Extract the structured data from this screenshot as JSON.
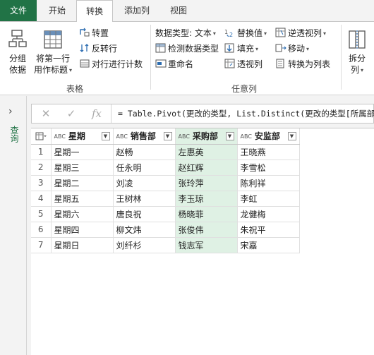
{
  "tabs": {
    "file": "文件",
    "home": "开始",
    "transform": "转换",
    "add_column": "添加列",
    "view": "视图"
  },
  "ribbon": {
    "table_group": {
      "label": "表格",
      "group_by": "分组\n依据",
      "use_first_row": "将第一行\n用作标题",
      "transpose": "转置",
      "reverse_rows": "反转行",
      "count_rows": "对行进行计数"
    },
    "any_column_group": {
      "label": "任意列",
      "data_type": "数据类型: 文本",
      "detect_type": "检测数据类型",
      "rename": "重命名",
      "replace_values": "替换值",
      "fill": "填充",
      "pivot": "透视列",
      "unpivot": "逆透视列",
      "move": "移动",
      "to_list": "转换为列表"
    },
    "split_column": "拆分\n列"
  },
  "nav": {
    "label": "查询"
  },
  "formula": {
    "text": "= Table.Pivot(更改的类型, List.Distinct(更改的类型[所属部门"
  },
  "grid": {
    "columns": [
      "星期",
      "销售部",
      "采购部",
      "安监部"
    ],
    "type_badge": "ABC",
    "rows": [
      [
        "1",
        "星期一",
        "赵畅",
        "左惠英",
        "王晓燕"
      ],
      [
        "2",
        "星期三",
        "任永明",
        "赵红辉",
        "李雪松"
      ],
      [
        "3",
        "星期二",
        "刘凌",
        "张玲萍",
        "陈利祥"
      ],
      [
        "4",
        "星期五",
        "王树林",
        "李玉琼",
        "李虹"
      ],
      [
        "5",
        "星期六",
        "唐良祝",
        "杨晓菲",
        "龙健梅"
      ],
      [
        "6",
        "星期四",
        "柳文炜",
        "张俊伟",
        "朱祝平"
      ],
      [
        "7",
        "星期日",
        "刘纤杉",
        "钱志军",
        "宋嘉"
      ]
    ]
  },
  "colors": {
    "accent": "#217346",
    "selected_column": "#dff1e4"
  }
}
